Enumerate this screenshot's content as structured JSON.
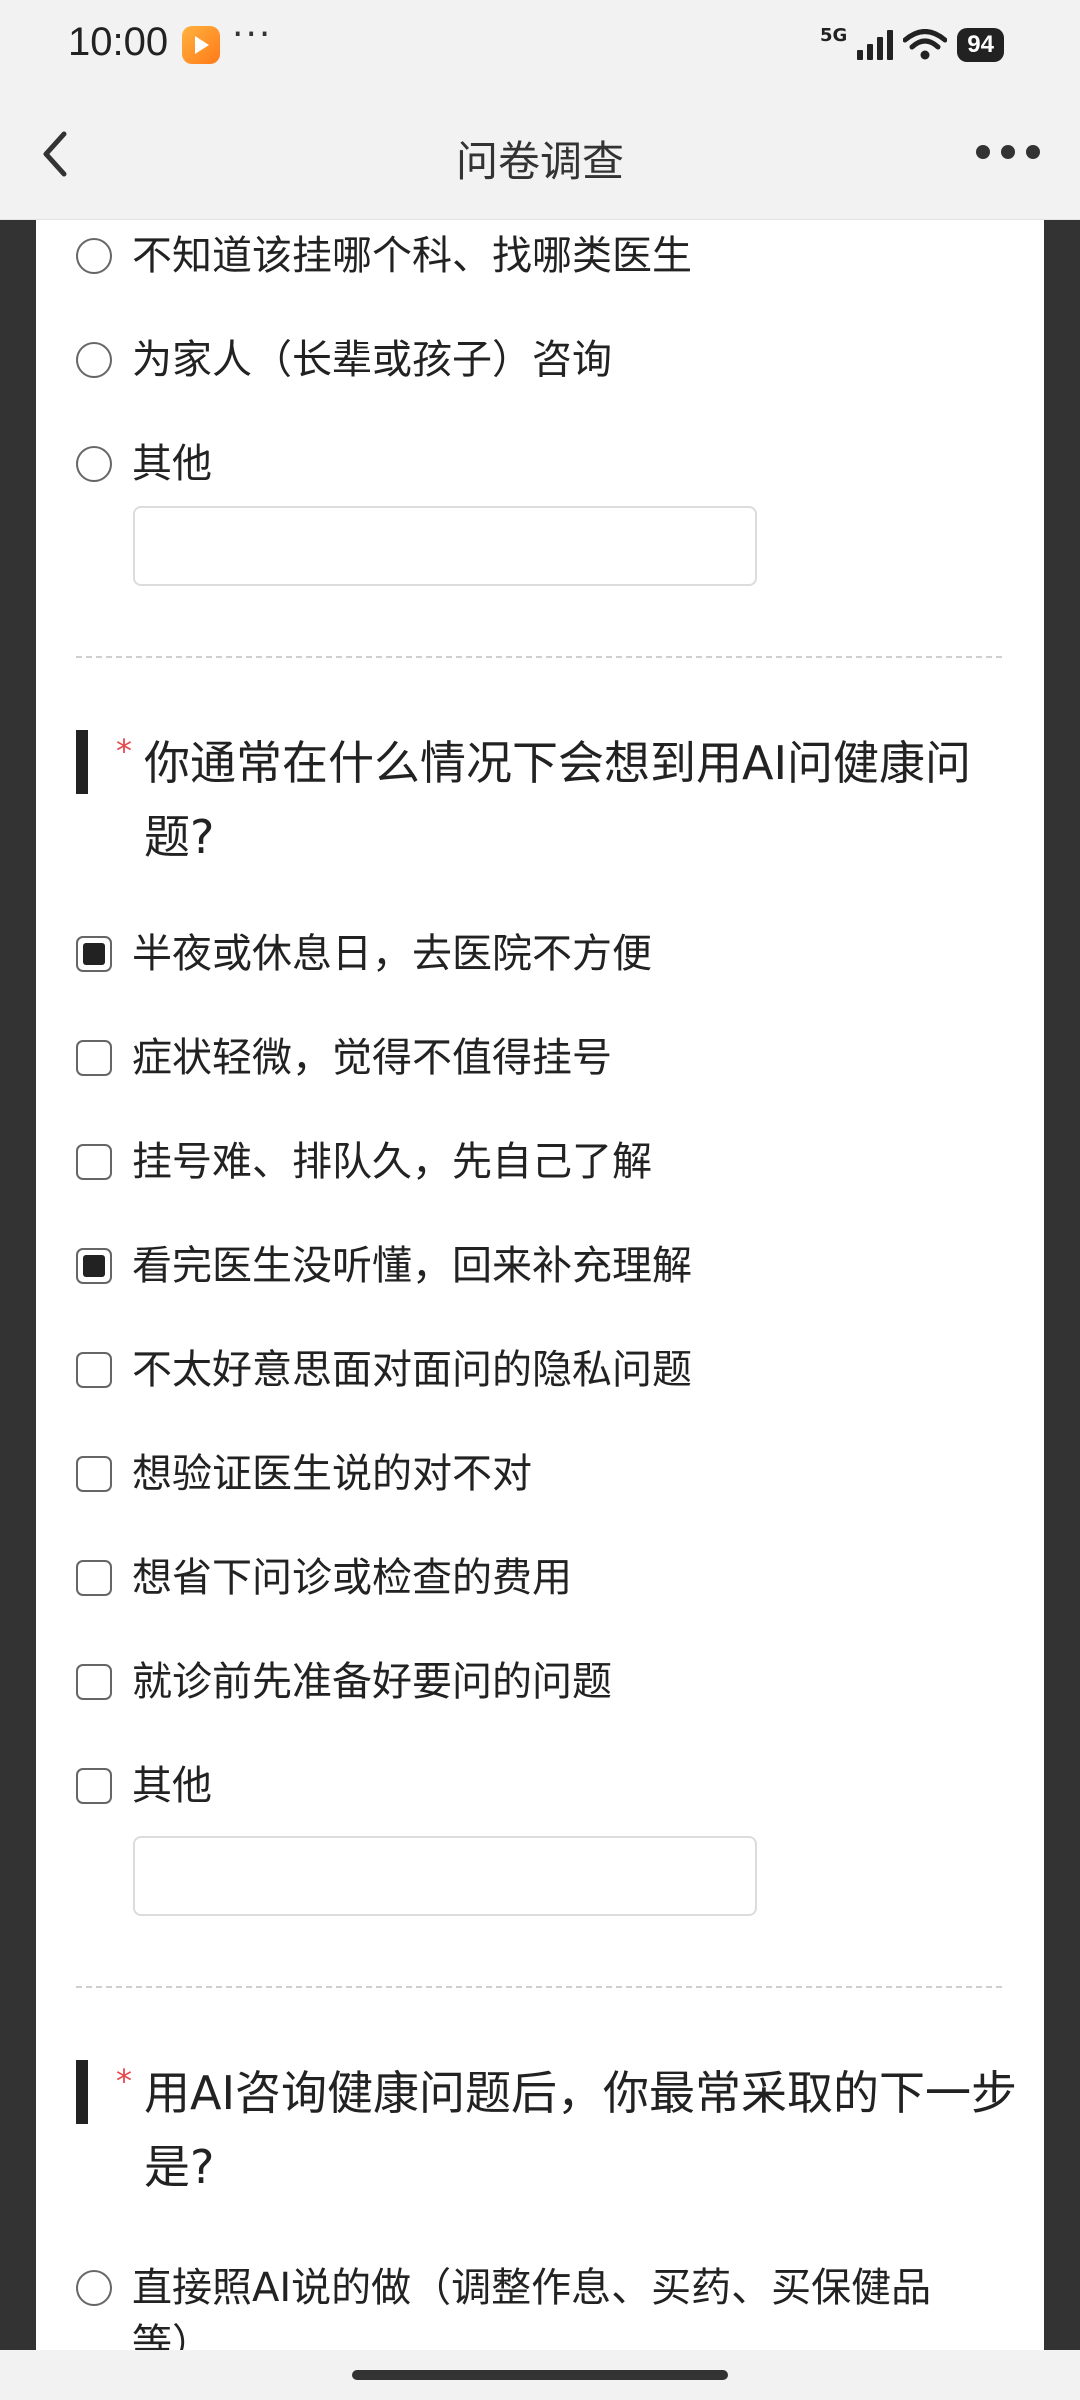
{
  "status_bar": {
    "time": "10:00",
    "notification_more": "···",
    "network": "5G",
    "battery": "94"
  },
  "nav": {
    "title": "问卷调查"
  },
  "previous_question_options": [
    {
      "label": "不知道该挂哪个科、找哪类医生",
      "type": "radio",
      "checked": false
    },
    {
      "label": "为家人（长辈或孩子）咨询",
      "type": "radio",
      "checked": false
    },
    {
      "label": "其他",
      "type": "radio",
      "checked": false
    }
  ],
  "previous_other_input": {
    "value": "",
    "placeholder": ""
  },
  "question2": {
    "required_mark": "*",
    "title": "你通常在什么情况下会想到用AI问健康问题?",
    "options": [
      {
        "label": "半夜或休息日，去医院不方便",
        "type": "checkbox",
        "checked": true
      },
      {
        "label": "症状轻微，觉得不值得挂号",
        "type": "checkbox",
        "checked": false
      },
      {
        "label": "挂号难、排队久，先自己了解",
        "type": "checkbox",
        "checked": false
      },
      {
        "label": "看完医生没听懂，回来补充理解",
        "type": "checkbox",
        "checked": true
      },
      {
        "label": "不太好意思面对面问的隐私问题",
        "type": "checkbox",
        "checked": false
      },
      {
        "label": "想验证医生说的对不对",
        "type": "checkbox",
        "checked": false
      },
      {
        "label": "想省下问诊或检查的费用",
        "type": "checkbox",
        "checked": false
      },
      {
        "label": "就诊前先准备好要问的问题",
        "type": "checkbox",
        "checked": false
      },
      {
        "label": "其他",
        "type": "checkbox",
        "checked": false
      }
    ],
    "other_input": {
      "value": "",
      "placeholder": ""
    }
  },
  "question3": {
    "required_mark": "*",
    "title": "用AI咨询健康问题后，你最常采取的下一步是?",
    "options": [
      {
        "label": "直接照AI说的做（调整作息、买药、买保健品等）",
        "type": "radio",
        "checked": false
      }
    ]
  }
}
